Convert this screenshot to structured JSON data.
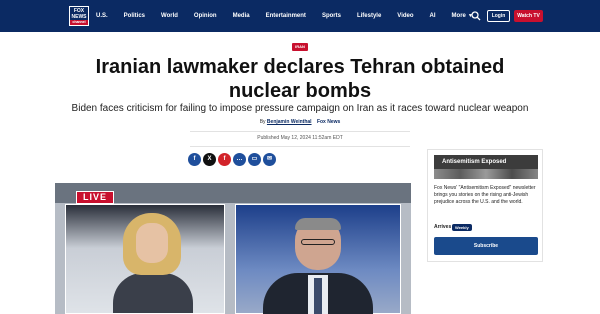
{
  "header": {
    "logo": {
      "line1": "FOX",
      "line2": "NEWS",
      "line3": "channel"
    },
    "nav_items": [
      "U.S.",
      "Politics",
      "World",
      "Opinion",
      "Media",
      "Entertainment",
      "Sports",
      "Lifestyle",
      "Video",
      "AI"
    ],
    "more_label": "More",
    "login_label": "Login",
    "watch_label": "Watch TV",
    "colors": {
      "bar": "#0b2a63",
      "accent": "#c8102e"
    }
  },
  "article": {
    "tag": "IRAN",
    "headline": "Iranian lawmaker declares Tehran obtained nuclear bombs",
    "subheadline": "Biden faces criticism for failing to impose pressure campaign on Iran as it races toward nuclear weapon",
    "by_prefix": "By",
    "author": "Benjamin Weinthal",
    "publisher": "Fox News",
    "published": "Published May 12, 2024 11:52am EDT",
    "share_icons": [
      {
        "name": "facebook-icon",
        "glyph": "f",
        "color": "#1f4f9c"
      },
      {
        "name": "x-icon",
        "glyph": "X",
        "color": "#111111"
      },
      {
        "name": "flipboard-icon",
        "glyph": "f",
        "color": "#d2232a"
      },
      {
        "name": "comment-icon",
        "glyph": "…",
        "color": "#1f4f9c"
      },
      {
        "name": "print-icon",
        "glyph": "▭",
        "color": "#1f4f9c"
      },
      {
        "name": "email-icon",
        "glyph": "✉",
        "color": "#1f4f9c"
      }
    ],
    "video": {
      "live_label": "LIVE"
    }
  },
  "sidebar": {
    "promo_title": "Antisemitism Exposed",
    "description": "Fox News' \"Antisemitism Exposed\" newsletter brings you stories on the rising anti-Jewish prejudice across the U.S. and the world.",
    "arrives_label": "Arrives",
    "frequency": "Weekly",
    "subscribe_label": "Subscribe"
  }
}
